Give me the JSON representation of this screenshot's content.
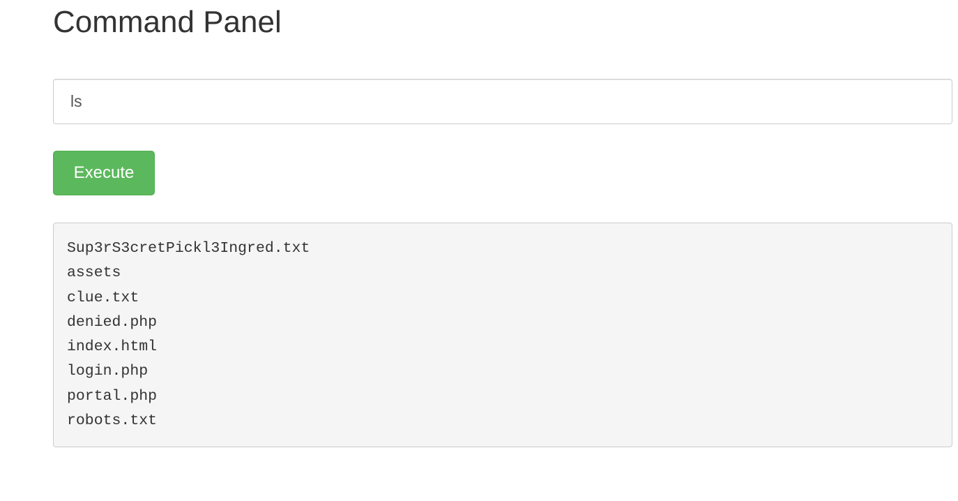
{
  "page": {
    "title": "Command Panel"
  },
  "command": {
    "value": "ls"
  },
  "execute_button": {
    "label": "Execute"
  },
  "output": {
    "lines": [
      "Sup3rS3cretPickl3Ingred.txt",
      "assets",
      "clue.txt",
      "denied.php",
      "index.html",
      "login.php",
      "portal.php",
      "robots.txt"
    ]
  },
  "colors": {
    "button": "#5cb85c",
    "output_background": "#f5f5f5"
  }
}
